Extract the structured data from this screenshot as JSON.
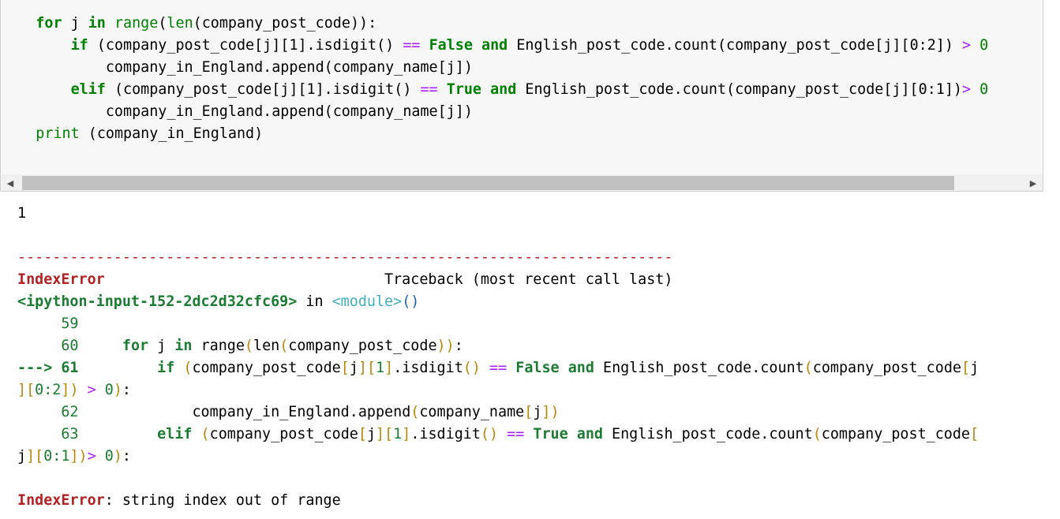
{
  "code_cell": {
    "lines": [
      [
        [
          "",
          "    "
        ],
        [
          "kw",
          "for"
        ],
        [
          "",
          " j "
        ],
        [
          "kw",
          "in"
        ],
        [
          "",
          " "
        ],
        [
          "bi",
          "range"
        ],
        [
          "",
          "("
        ],
        [
          "bi",
          "len"
        ],
        [
          "",
          "(company_post_code)):"
        ]
      ],
      [
        [
          "",
          "        "
        ],
        [
          "kw",
          "if"
        ],
        [
          "",
          " (company_post_code[j][1].isdigit() "
        ],
        [
          "op",
          "=="
        ],
        [
          "",
          " "
        ],
        [
          "kw",
          "False"
        ],
        [
          "",
          " "
        ],
        [
          "kw",
          "and"
        ],
        [
          "",
          " English_post_code.count(company_post_code[j][0:2]) "
        ],
        [
          "op",
          ">"
        ],
        [
          "",
          " "
        ],
        [
          "num",
          "0"
        ]
      ],
      [
        [
          "",
          "            company_in_England.append(company_name[j])"
        ]
      ],
      [
        [
          "",
          "        "
        ],
        [
          "kw",
          "elif"
        ],
        [
          "",
          " (company_post_code[j][1].isdigit() "
        ],
        [
          "op",
          "=="
        ],
        [
          "",
          " "
        ],
        [
          "kw",
          "True"
        ],
        [
          "",
          " "
        ],
        [
          "kw",
          "and"
        ],
        [
          "",
          " English_post_code.count(company_post_code[j][0:1])"
        ],
        [
          "op",
          ">"
        ],
        [
          "",
          " "
        ],
        [
          "num",
          "0"
        ]
      ],
      [
        [
          "",
          "            company_in_England.append(company_name[j])"
        ]
      ],
      [
        [
          "",
          "    "
        ],
        [
          "bi",
          "print"
        ],
        [
          "",
          " (company_in_England)"
        ]
      ]
    ]
  },
  "scrollbar": {
    "left_arrow": "◀",
    "right_arrow": "▶"
  },
  "output": {
    "lines": [
      [
        [
          "",
          "1"
        ]
      ],
      [
        [
          "",
          ""
        ]
      ],
      [
        [
          "dash",
          "---------------------------------------------------------------------------"
        ]
      ],
      [
        [
          "tk-red",
          "IndexError"
        ],
        [
          "",
          "                                Traceback (most recent call last)"
        ]
      ],
      [
        [
          "tk-greenb",
          "<ipython-input-152-2dc2d32cfc69>"
        ],
        [
          "",
          " in "
        ],
        [
          "tk-cyan",
          "<module>"
        ],
        [
          "tk-blue",
          "()"
        ]
      ],
      [
        [
          "tk-green",
          "     59"
        ]
      ],
      [
        [
          "tk-green",
          "     60"
        ],
        [
          "",
          "     "
        ],
        [
          "tk-greenb",
          "for"
        ],
        [
          "",
          " j "
        ],
        [
          "tk-greenb",
          "in"
        ],
        [
          "",
          " range"
        ],
        [
          "tk-gold",
          "("
        ],
        [
          "",
          "len"
        ],
        [
          "tk-gold",
          "("
        ],
        [
          "",
          "company_post_code"
        ],
        [
          "tk-gold",
          "))"
        ],
        [
          "",
          ":"
        ]
      ],
      [
        [
          "tk-greenb",
          "---> 61"
        ],
        [
          "",
          "         "
        ],
        [
          "tk-greenb",
          "if"
        ],
        [
          "",
          " "
        ],
        [
          "tk-gold",
          "("
        ],
        [
          "",
          "company_post_code"
        ],
        [
          "tk-gold",
          "["
        ],
        [
          "",
          "j"
        ],
        [
          "tk-gold",
          "]["
        ],
        [
          "tk-green",
          "1"
        ],
        [
          "tk-gold",
          "]"
        ],
        [
          ".",
          "."
        ],
        [
          "",
          "isdigit"
        ],
        [
          "tk-gold",
          "()"
        ],
        [
          "",
          " "
        ],
        [
          "op",
          "=="
        ],
        [
          "",
          " "
        ],
        [
          "tk-greenb",
          "False"
        ],
        [
          "",
          " "
        ],
        [
          "tk-greenb",
          "and"
        ],
        [
          "",
          " English_post_code"
        ],
        [
          "",
          ".count"
        ],
        [
          "tk-gold",
          "("
        ],
        [
          "",
          "company_post_code"
        ],
        [
          "tk-gold",
          "["
        ],
        [
          "",
          "j"
        ]
      ],
      [
        [
          "tk-gold",
          "]["
        ],
        [
          "tk-green",
          "0:2"
        ],
        [
          "tk-gold",
          "])"
        ],
        [
          "",
          " "
        ],
        [
          "op",
          ">"
        ],
        [
          "",
          " "
        ],
        [
          "tk-green",
          "0"
        ],
        [
          "tk-gold",
          ")"
        ],
        [
          "",
          ":"
        ]
      ],
      [
        [
          "tk-green",
          "     62"
        ],
        [
          "",
          "             company_in_England"
        ],
        [
          "",
          ".append"
        ],
        [
          "tk-gold",
          "("
        ],
        [
          "",
          "company_name"
        ],
        [
          "tk-gold",
          "["
        ],
        [
          "",
          "j"
        ],
        [
          "tk-gold",
          "])"
        ]
      ],
      [
        [
          "tk-green",
          "     63"
        ],
        [
          "",
          "         "
        ],
        [
          "tk-greenb",
          "elif"
        ],
        [
          "",
          " "
        ],
        [
          "tk-gold",
          "("
        ],
        [
          "",
          "company_post_code"
        ],
        [
          "tk-gold",
          "["
        ],
        [
          "",
          "j"
        ],
        [
          "tk-gold",
          "]["
        ],
        [
          "tk-green",
          "1"
        ],
        [
          "tk-gold",
          "]"
        ],
        [
          "",
          ".isdigit"
        ],
        [
          "tk-gold",
          "()"
        ],
        [
          "",
          " "
        ],
        [
          "op",
          "=="
        ],
        [
          "",
          " "
        ],
        [
          "tk-greenb",
          "True"
        ],
        [
          "",
          " "
        ],
        [
          "tk-greenb",
          "and"
        ],
        [
          "",
          " English_post_code.count"
        ],
        [
          "tk-gold",
          "("
        ],
        [
          "",
          "company_post_code"
        ],
        [
          "tk-gold",
          "["
        ]
      ],
      [
        [
          "",
          "j"
        ],
        [
          "tk-gold",
          "]["
        ],
        [
          "tk-green",
          "0:1"
        ],
        [
          "tk-gold",
          "])"
        ],
        [
          "op",
          ">"
        ],
        [
          "",
          " "
        ],
        [
          "tk-green",
          "0"
        ],
        [
          "tk-gold",
          ")"
        ],
        [
          "",
          ":"
        ]
      ],
      [
        [
          "",
          ""
        ]
      ],
      [
        [
          "tk-red",
          "IndexError"
        ],
        [
          "",
          ": string index out of range"
        ]
      ]
    ]
  }
}
